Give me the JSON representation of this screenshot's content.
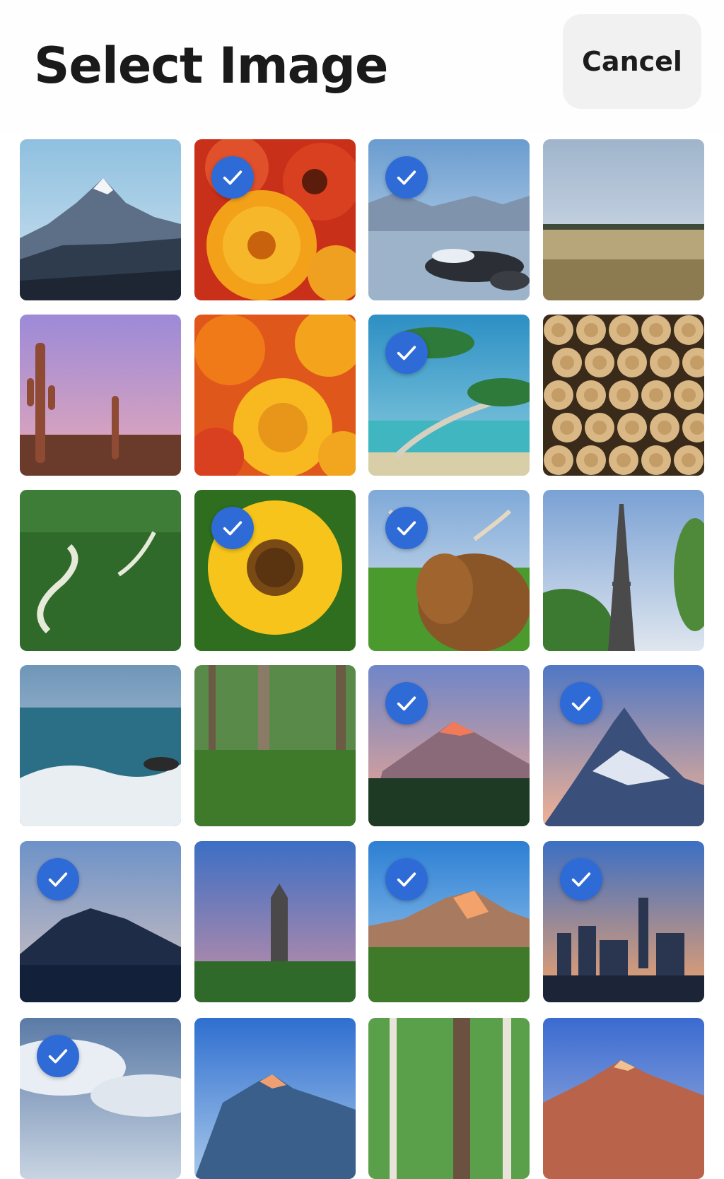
{
  "header": {
    "title": "Select Image",
    "cancel_label": "Cancel"
  },
  "check_color": "#2f6bd6",
  "images": [
    {
      "subject": "snowy-mountain",
      "selected": false
    },
    {
      "subject": "red-orange-flowers",
      "selected": true
    },
    {
      "subject": "misty-lake-rocks",
      "selected": true
    },
    {
      "subject": "grass-field",
      "selected": false
    },
    {
      "subject": "desert-cactus",
      "selected": false
    },
    {
      "subject": "orange-roses",
      "selected": false
    },
    {
      "subject": "palm-tree-beach",
      "selected": true
    },
    {
      "subject": "stacked-logs",
      "selected": false
    },
    {
      "subject": "green-valley-road",
      "selected": false
    },
    {
      "subject": "yellow-sunflower",
      "selected": true
    },
    {
      "subject": "highland-cow",
      "selected": true
    },
    {
      "subject": "eiffel-tower",
      "selected": false
    },
    {
      "subject": "ocean-waves",
      "selected": false
    },
    {
      "subject": "forest",
      "selected": false
    },
    {
      "subject": "sunset-mountain",
      "selected": true
    },
    {
      "subject": "matterhorn-peak",
      "selected": true
    },
    {
      "subject": "dark-volcano",
      "selected": true
    },
    {
      "subject": "castle-tower-sunset",
      "selected": false
    },
    {
      "subject": "sunlit-mountains",
      "selected": true
    },
    {
      "subject": "city-skyline-sunset",
      "selected": true
    },
    {
      "subject": "clouds",
      "selected": true
    },
    {
      "subject": "blue-mountain",
      "selected": false
    },
    {
      "subject": "birch-forest",
      "selected": false
    },
    {
      "subject": "alpenglow-peak",
      "selected": false
    }
  ]
}
